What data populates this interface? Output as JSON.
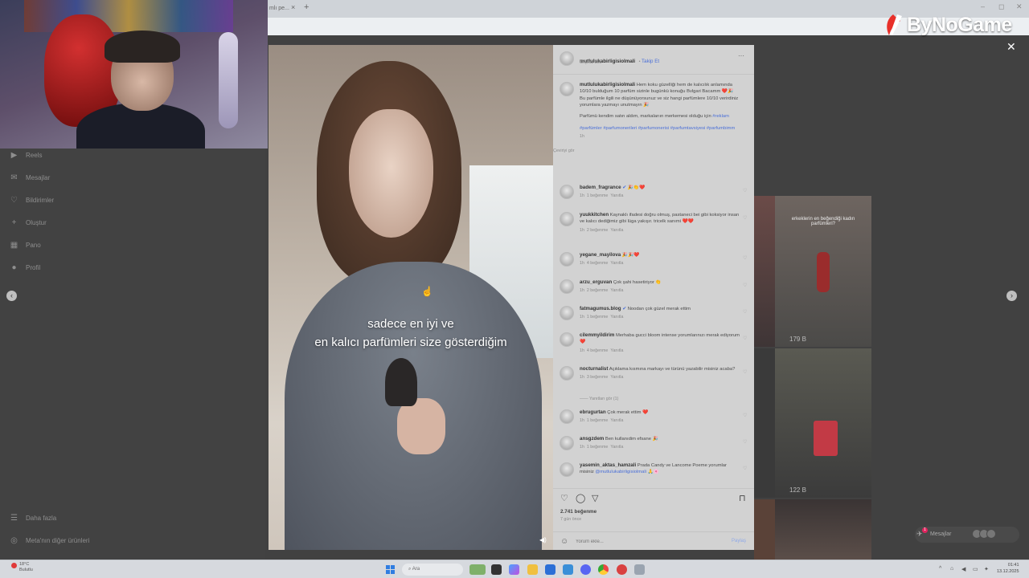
{
  "browser": {
    "tab_title": "mlı pe...",
    "tab_close": "×",
    "new_tab": "+",
    "win_min": "–",
    "win_max": "◻",
    "win_close": "✕"
  },
  "sidebar": {
    "items": [
      {
        "label": "Reels",
        "icon": "reels-icon",
        "glyph": "▶"
      },
      {
        "label": "Mesajlar",
        "icon": "messages-icon",
        "glyph": "✉"
      },
      {
        "label": "Bildirimler",
        "icon": "heart-icon",
        "glyph": "♡"
      },
      {
        "label": "Oluştur",
        "icon": "plus-icon",
        "glyph": "+"
      },
      {
        "label": "Pano",
        "icon": "dashboard-icon",
        "glyph": "▦"
      },
      {
        "label": "Profil",
        "icon": "profile-icon",
        "glyph": "●"
      },
      {
        "label": "Daha fazla",
        "icon": "menu-icon",
        "glyph": "☰"
      },
      {
        "label": "Meta'nın diğer ürünleri",
        "icon": "meta-icon",
        "glyph": "◎"
      }
    ]
  },
  "logo": {
    "text": "ByNoGame"
  },
  "modal": {
    "close": "✕",
    "prev": "‹",
    "next": "›"
  },
  "video": {
    "caption_line1": "sadece en iyi ve",
    "caption_line2": "en kalıcı parfümleri size gösterdiğim",
    "sound": "◀)"
  },
  "post": {
    "username": "mutlulukabirligisiolmali",
    "follow": "Takip Et",
    "audio": "Orijinal ses",
    "more": "···",
    "caption": "Hem koku güzelliği hem de kalıcılık anlamında 10/10 bulduğum 10 parfüm sizinle bugünkü konuğu Bvlgari Bacamm ❤️🎉 Bu parfümle ilgili ne düşünüyorsunuz ve siz hangi parfümlere 10/10 verirdiniz yorumlara yazmayı unutmayın 🎉",
    "caption2": "Parfümü kendim satın aldım, markalarıın merkemesi olduğu için",
    "caption2_tag": "#reklam",
    "hashtags": "#parfümler #parfumonerileri #parfumonerisi #parfumtavsiyesi #parfumbimm",
    "caption_time": "1h",
    "see_translation": "Çeviriyi gör"
  },
  "comments": [
    {
      "user": "badem_fragrance",
      "text": "🎉👏❤️",
      "time": "1h",
      "likes": "1 beğenme",
      "reply": "Yanıtla",
      "badge": true
    },
    {
      "user": "yuukkitchen",
      "text": "Kaynaklı ifadesi doğru olmuş, pastaneci bei gibi koksiyor insan ve kalıcı dediğimiz gibi lüga yakışır. tricelk sanımi ❤️❤️",
      "time": "1h",
      "likes": "2 beğenme",
      "reply": "Yanıtla",
      "badge": false
    },
    {
      "user": "yegane_mayilova",
      "text": "🎉🎉❤️",
      "time": "1h",
      "likes": "4 beğenme",
      "reply": "Yanıtla",
      "badge": false
    },
    {
      "user": "arzu_erguvan",
      "text": "Çok şahi hasetiriyor 👏",
      "time": "1h",
      "likes": "2 beğenme",
      "reply": "Yanıtla",
      "badge": false
    },
    {
      "user": "fatmagumus.blog",
      "text": "Noodan çok güzel merak ettim",
      "time": "1h",
      "likes": "1 beğenme",
      "reply": "Yanıtla",
      "badge": true
    },
    {
      "user": "cilemmyildirim",
      "text": "Merhaba gucci bloom intense yorumlarınızı merak ediyorum ❤️",
      "time": "1h",
      "likes": "4 beğenme",
      "reply": "Yanıtla",
      "badge": false
    },
    {
      "user": "nocturnalist",
      "text": "Açıklama kısmına markayı ve türünü yazabilir misiniz acaba?",
      "time": "1h",
      "likes": "3 beğenme",
      "reply": "Yanıtla",
      "badge": false
    },
    {
      "user": "ebrugurtan",
      "text": "Çok merak ettim ❤️",
      "time": "1h",
      "likes": "1 beğenme",
      "reply": "Yanıtla",
      "badge": false
    },
    {
      "user": "ansgzdem",
      "text": "Ben kullanıdim efsane 🎉",
      "time": "1h",
      "likes": "1 beğenme",
      "reply": "Yanıtla",
      "badge": false
    },
    {
      "user": "yasemin_aktas_hamzali",
      "text": "Prada Candy ve Lancome Poeme yorumlar misiniz",
      "mention": "@mutlulukabirligisiolmali",
      "tail": "🙏🌸",
      "time": "1h",
      "likes": "",
      "reply": "",
      "badge": false
    }
  ],
  "view_replies": "Yanıtları gör (1)",
  "footer": {
    "likes": "2.741 beğenme",
    "date": "7 gün önce",
    "comment_placeholder": "Yorum ekle...",
    "share": "Paylaş"
  },
  "grid": {
    "cell1_text": "erkeklerin en beğendiği kadın parfümleri?",
    "cell1_count": "179 B",
    "cell2_count": "122 B"
  },
  "messages_widget": {
    "label": "Mesajlar",
    "badge": "1"
  },
  "taskbar": {
    "weather_temp": "18°C",
    "weather_desc": "Bulutlu",
    "search": "Ara",
    "time": "01:41",
    "date": "13.12.2025"
  }
}
